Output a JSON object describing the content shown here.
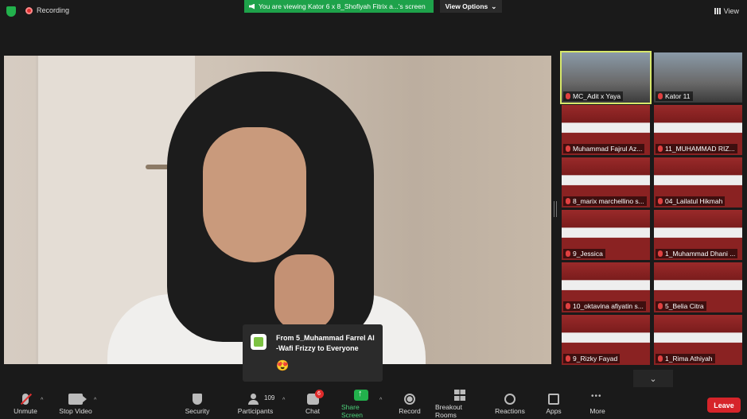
{
  "top": {
    "recording_label": "Recording",
    "viewing_banner": "You are viewing Kator 6 x 8_Shofiyah Fitrix a...'s screen",
    "view_options": "View Options",
    "view_button": "View"
  },
  "gallery": {
    "tiles": [
      {
        "label": "MC_Adit x Yaya"
      },
      {
        "label": "Kator 11"
      },
      {
        "label": "Muhammad Fajrul Az..."
      },
      {
        "label": "11_MUHAMMAD RIZ..."
      },
      {
        "label": "8_marix marchellino s..."
      },
      {
        "label": "04_Lailatul Hikmah"
      },
      {
        "label": "9_Jessica"
      },
      {
        "label": "1_Muhammad Dhani ..."
      },
      {
        "label": "10_oktavina afiyatin s..."
      },
      {
        "label": "5_Belia Citra"
      },
      {
        "label": "9_Rizky Fayad"
      },
      {
        "label": "1_Rima Athiyah"
      }
    ]
  },
  "chat_toast": {
    "text": "From 5_Muhammad Farrel Al -Wafi Frizzy to Everyone",
    "emoji": "😍"
  },
  "toolbar": {
    "unmute": "Unmute",
    "stop_video": "Stop Video",
    "security": "Security",
    "participants": "Participants",
    "participants_count": "109",
    "chat": "Chat",
    "chat_badge": "6",
    "share_screen": "Share Screen",
    "record": "Record",
    "breakout_rooms": "Breakout Rooms",
    "reactions": "Reactions",
    "apps": "Apps",
    "more": "More",
    "leave": "Leave"
  }
}
